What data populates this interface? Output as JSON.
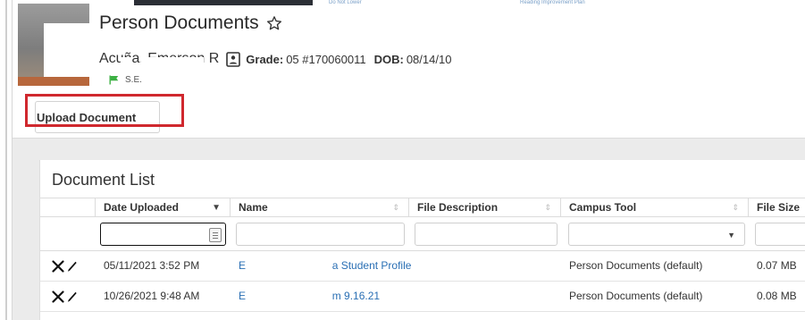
{
  "header": {
    "page_title": "Person Documents",
    "student_name": "Acuña, Emerson R",
    "grade_label": "Grade:",
    "grade_value": "05 #170060011",
    "dob_label": "DOB:",
    "dob_value": "08/14/10",
    "flag_label": "S.E.",
    "top_strip_left": "Do Not Lower",
    "top_strip_right": "Reading Improvement Plan"
  },
  "toolbar": {
    "upload_label": "Upload Document"
  },
  "document_list": {
    "title": "Document List",
    "columns": [
      "Date Uploaded",
      "Name",
      "File Description",
      "Campus Tool",
      "File Size"
    ],
    "rows": [
      {
        "date": "05/11/2021 3:52 PM",
        "name_start": "E",
        "name_end": "a Student Profile",
        "campus_tool": "Person Documents (default)",
        "size": "0.07 MB"
      },
      {
        "date": "10/26/2021 9:48 AM",
        "name_start": "E",
        "name_end": "m 9.16.21",
        "campus_tool": "Person Documents (default)",
        "size": "0.08 MB"
      }
    ]
  },
  "colors": {
    "highlight": "#d0282e",
    "link": "#2a6fb4",
    "flag": "#3cb043"
  }
}
